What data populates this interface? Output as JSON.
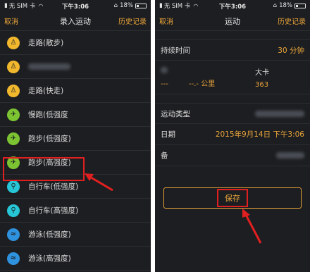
{
  "left_screen": {
    "status": {
      "carrier": "无 SIM 卡",
      "time": "下午3:06",
      "battery": "18%"
    },
    "nav": {
      "left": "取消",
      "title": "录入运动",
      "right": "历史记录"
    },
    "items": [
      {
        "label": "走路(散步)",
        "icon": "walking-icon",
        "color": "yellow"
      },
      {
        "label": "",
        "icon": "walking-icon",
        "color": "yellow"
      },
      {
        "label": "走路(快走)",
        "icon": "walking-icon",
        "color": "yellow"
      },
      {
        "label": "慢跑(低强度",
        "icon": "running-icon",
        "color": "green"
      },
      {
        "label": "跑步(低强度)",
        "icon": "running-icon",
        "color": "green"
      },
      {
        "label": "跑步(高强度)",
        "icon": "running-icon",
        "color": "green"
      },
      {
        "label": "自行车(低强度)",
        "icon": "cycling-icon",
        "color": "cyan"
      },
      {
        "label": "自行车(高强度)",
        "icon": "cycling-icon",
        "color": "cyan"
      },
      {
        "label": "游泳(低强度)",
        "icon": "swimming-icon",
        "color": "blue"
      },
      {
        "label": "游泳(高强度)",
        "icon": "swimming-icon",
        "color": "blue"
      }
    ]
  },
  "right_screen": {
    "status": {
      "carrier": "无 SIM 卡",
      "time": "下午3:06",
      "battery": "18%"
    },
    "nav": {
      "left": "取消",
      "title": "运动",
      "right": "历史记录"
    },
    "duration": {
      "label": "持续时间",
      "value": "30 分钟"
    },
    "distance": {
      "value": "---",
      "unit": "--.- 公里"
    },
    "calories": {
      "label": "大卡",
      "value": "363"
    },
    "type": {
      "label": "运动类型"
    },
    "date": {
      "label": "日期",
      "value": "2015年9月14日 下午3:06"
    },
    "note": {
      "label": "备"
    },
    "save_label": "保存"
  },
  "colors": {
    "accent": "#e8a33a",
    "background": "#1d1e21",
    "highlight": "#e02020"
  }
}
